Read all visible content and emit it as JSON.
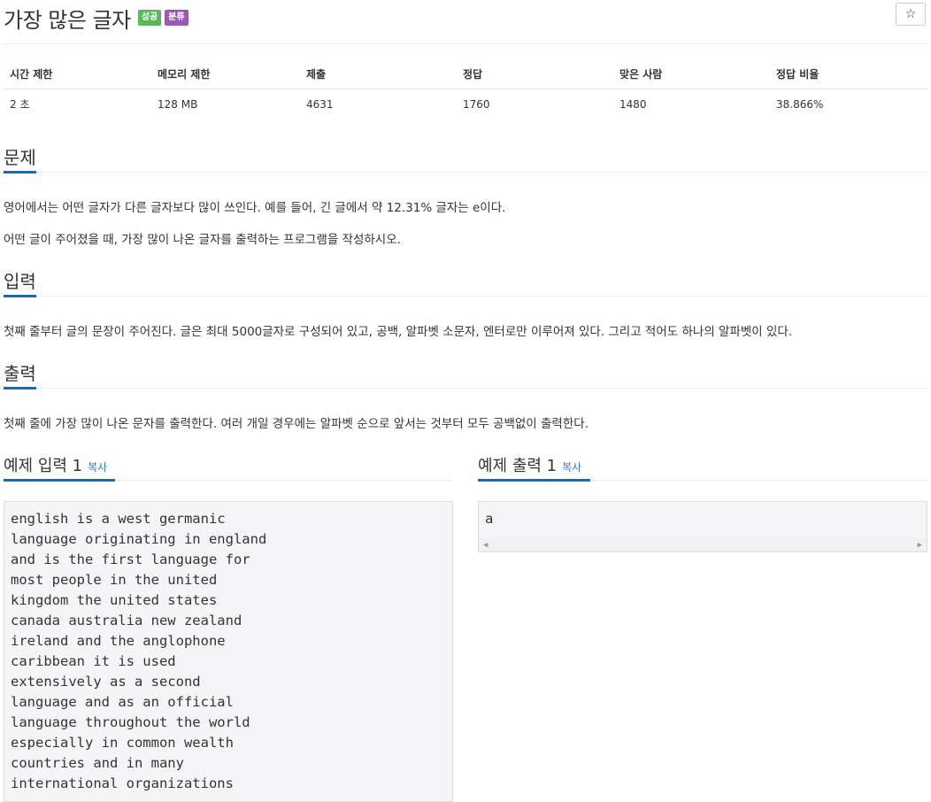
{
  "problem": {
    "title": "가장 많은 글자",
    "badges": {
      "status": "성공",
      "category": "분류"
    },
    "star_icon": "☆"
  },
  "info_table": {
    "headers": [
      "시간 제한",
      "메모리 제한",
      "제출",
      "정답",
      "맞은 사람",
      "정답 비율"
    ],
    "values": [
      "2 초",
      "128 MB",
      "4631",
      "1760",
      "1480",
      "38.866%"
    ]
  },
  "sections": {
    "description": {
      "heading": "문제",
      "paragraphs": [
        "영어에서는 어떤 글자가 다른 글자보다 많이 쓰인다. 예를 들어, 긴 글에서 약 12.31% 글자는 e이다.",
        "어떤 글이 주어졌을 때, 가장 많이 나온 글자를 출력하는 프로그램을 작성하시오."
      ]
    },
    "input": {
      "heading": "입력",
      "paragraphs": [
        "첫째 줄부터 글의 문장이 주어진다. 글은 최대 5000글자로 구성되어 있고, 공백, 알파벳 소문자, 엔터로만 이루어져 있다. 그리고 적어도 하나의 알파벳이 있다."
      ]
    },
    "output": {
      "heading": "출력",
      "paragraphs": [
        "첫째 줄에 가장 많이 나온 문자를 출력한다. 여러 개일 경우에는 알파벳 순으로 앞서는 것부터 모두 공백없이 출력한다."
      ]
    }
  },
  "samples": {
    "input": {
      "heading": "예제 입력 1",
      "copy_label": "복사",
      "lines": [
        "english is a west germanic",
        "language originating in england",
        "and is the first language for",
        "most people in the united",
        "kingdom the united states",
        "canada australia new zealand",
        "ireland and the anglophone",
        "caribbean it is used",
        "extensively as a second",
        "language and as an official",
        "language throughout the world",
        "especially in common wealth",
        "countries and in many",
        "international organizations"
      ]
    },
    "output": {
      "heading": "예제 출력 1",
      "copy_label": "복사",
      "lines": [
        "a"
      ]
    }
  },
  "colors": {
    "success": "#5cb85c",
    "category": "#9b59b6",
    "accent": "#0076c0",
    "link": "#337ab7"
  }
}
